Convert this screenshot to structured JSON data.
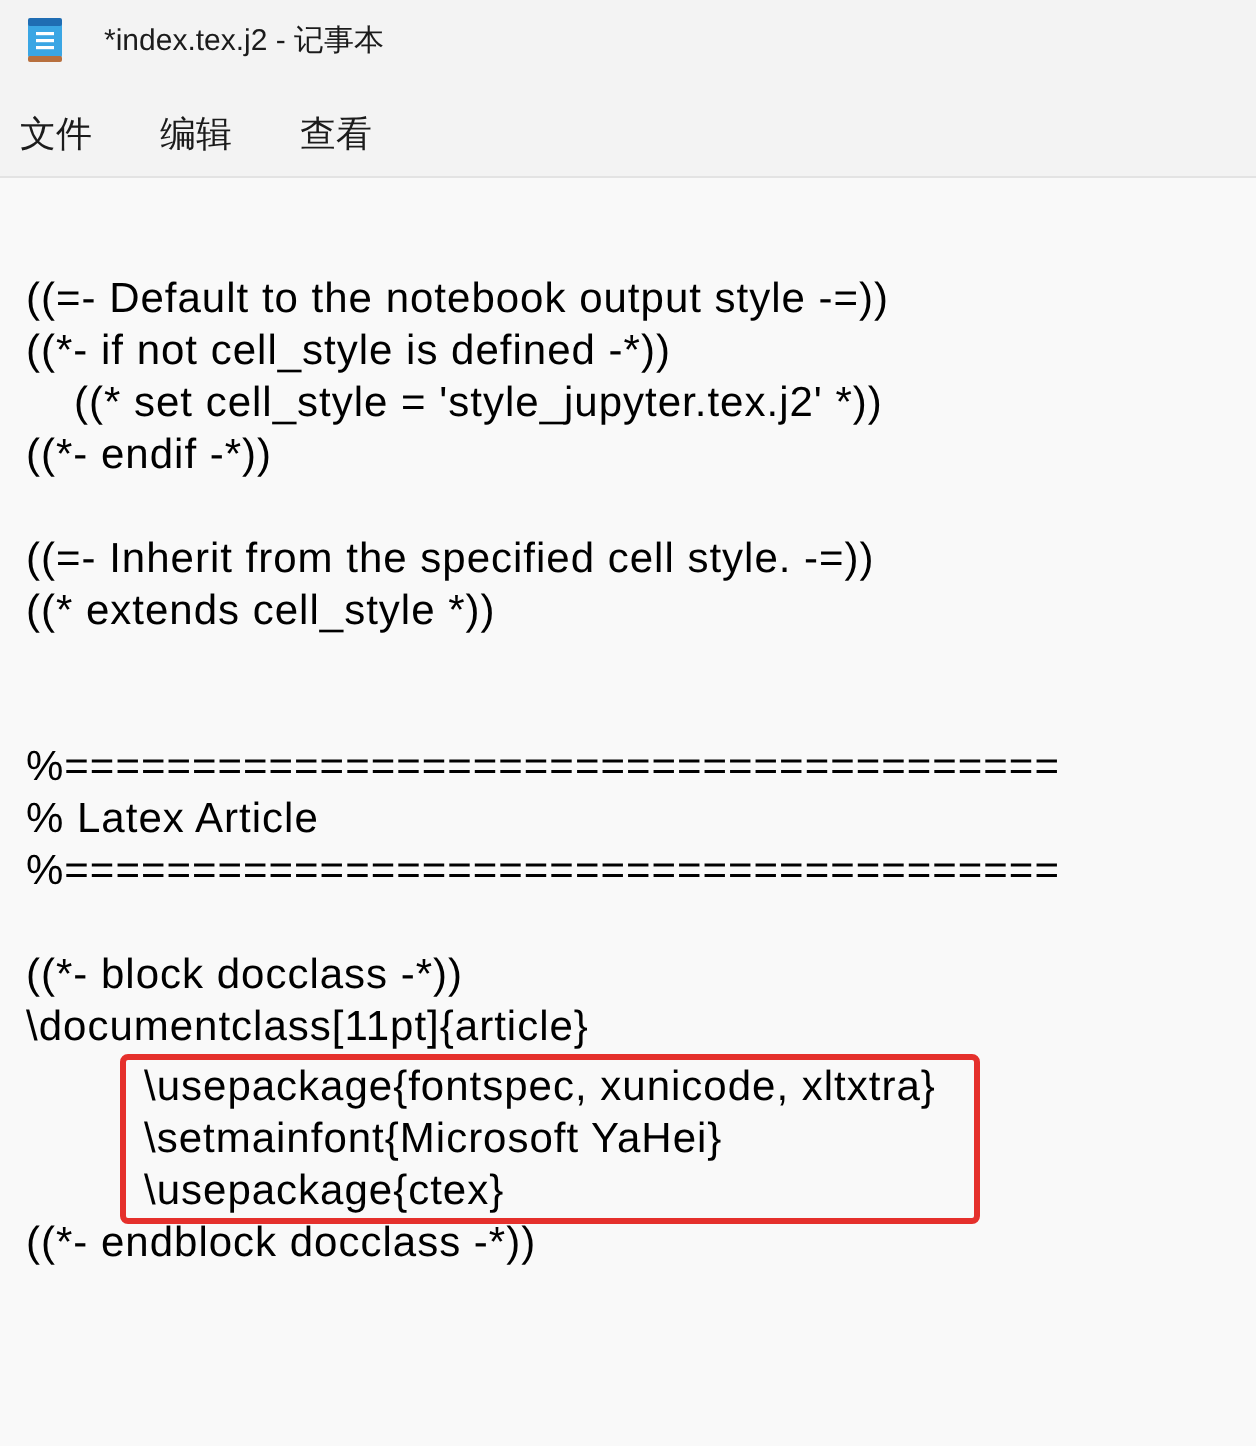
{
  "window": {
    "title": "*index.tex.j2 - 记事本"
  },
  "menu": [
    {
      "label": "文件"
    },
    {
      "label": "编辑"
    },
    {
      "label": "查看"
    }
  ],
  "editor": {
    "lines": [
      {
        "kind": "blank"
      },
      {
        "kind": "blank"
      },
      {
        "kind": "text",
        "text": "((=- Default to the notebook output style -=))"
      },
      {
        "kind": "text",
        "text": "((*- if not cell_style is defined -*))"
      },
      {
        "kind": "indent",
        "text": "((* set cell_style = 'style_jupyter.tex.j2' *))"
      },
      {
        "kind": "text",
        "text": "((*- endif -*))"
      },
      {
        "kind": "blank"
      },
      {
        "kind": "text",
        "text": "((=- Inherit from the specified cell style. -=))"
      },
      {
        "kind": "text",
        "text": "((* extends cell_style *))"
      },
      {
        "kind": "blank"
      },
      {
        "kind": "blank"
      },
      {
        "kind": "text",
        "text": "%======================================="
      },
      {
        "kind": "text",
        "text": "% Latex Article"
      },
      {
        "kind": "text",
        "text": "%======================================="
      },
      {
        "kind": "blank"
      },
      {
        "kind": "text",
        "text": "((*- block docclass -*))"
      },
      {
        "kind": "text",
        "text": "\\documentclass[11pt]{article}"
      },
      {
        "kind": "highlight",
        "lines": [
          {
            "kind": "tab",
            "text": "\\usepackage{fontspec, xunicode, xltxtra}"
          },
          {
            "kind": "tab",
            "text": "\\setmainfont{Microsoft YaHei}"
          },
          {
            "kind": "tab",
            "text": "\\usepackage{ctex}"
          }
        ]
      },
      {
        "kind": "text",
        "text": "((*- endblock docclass -*))"
      }
    ]
  }
}
